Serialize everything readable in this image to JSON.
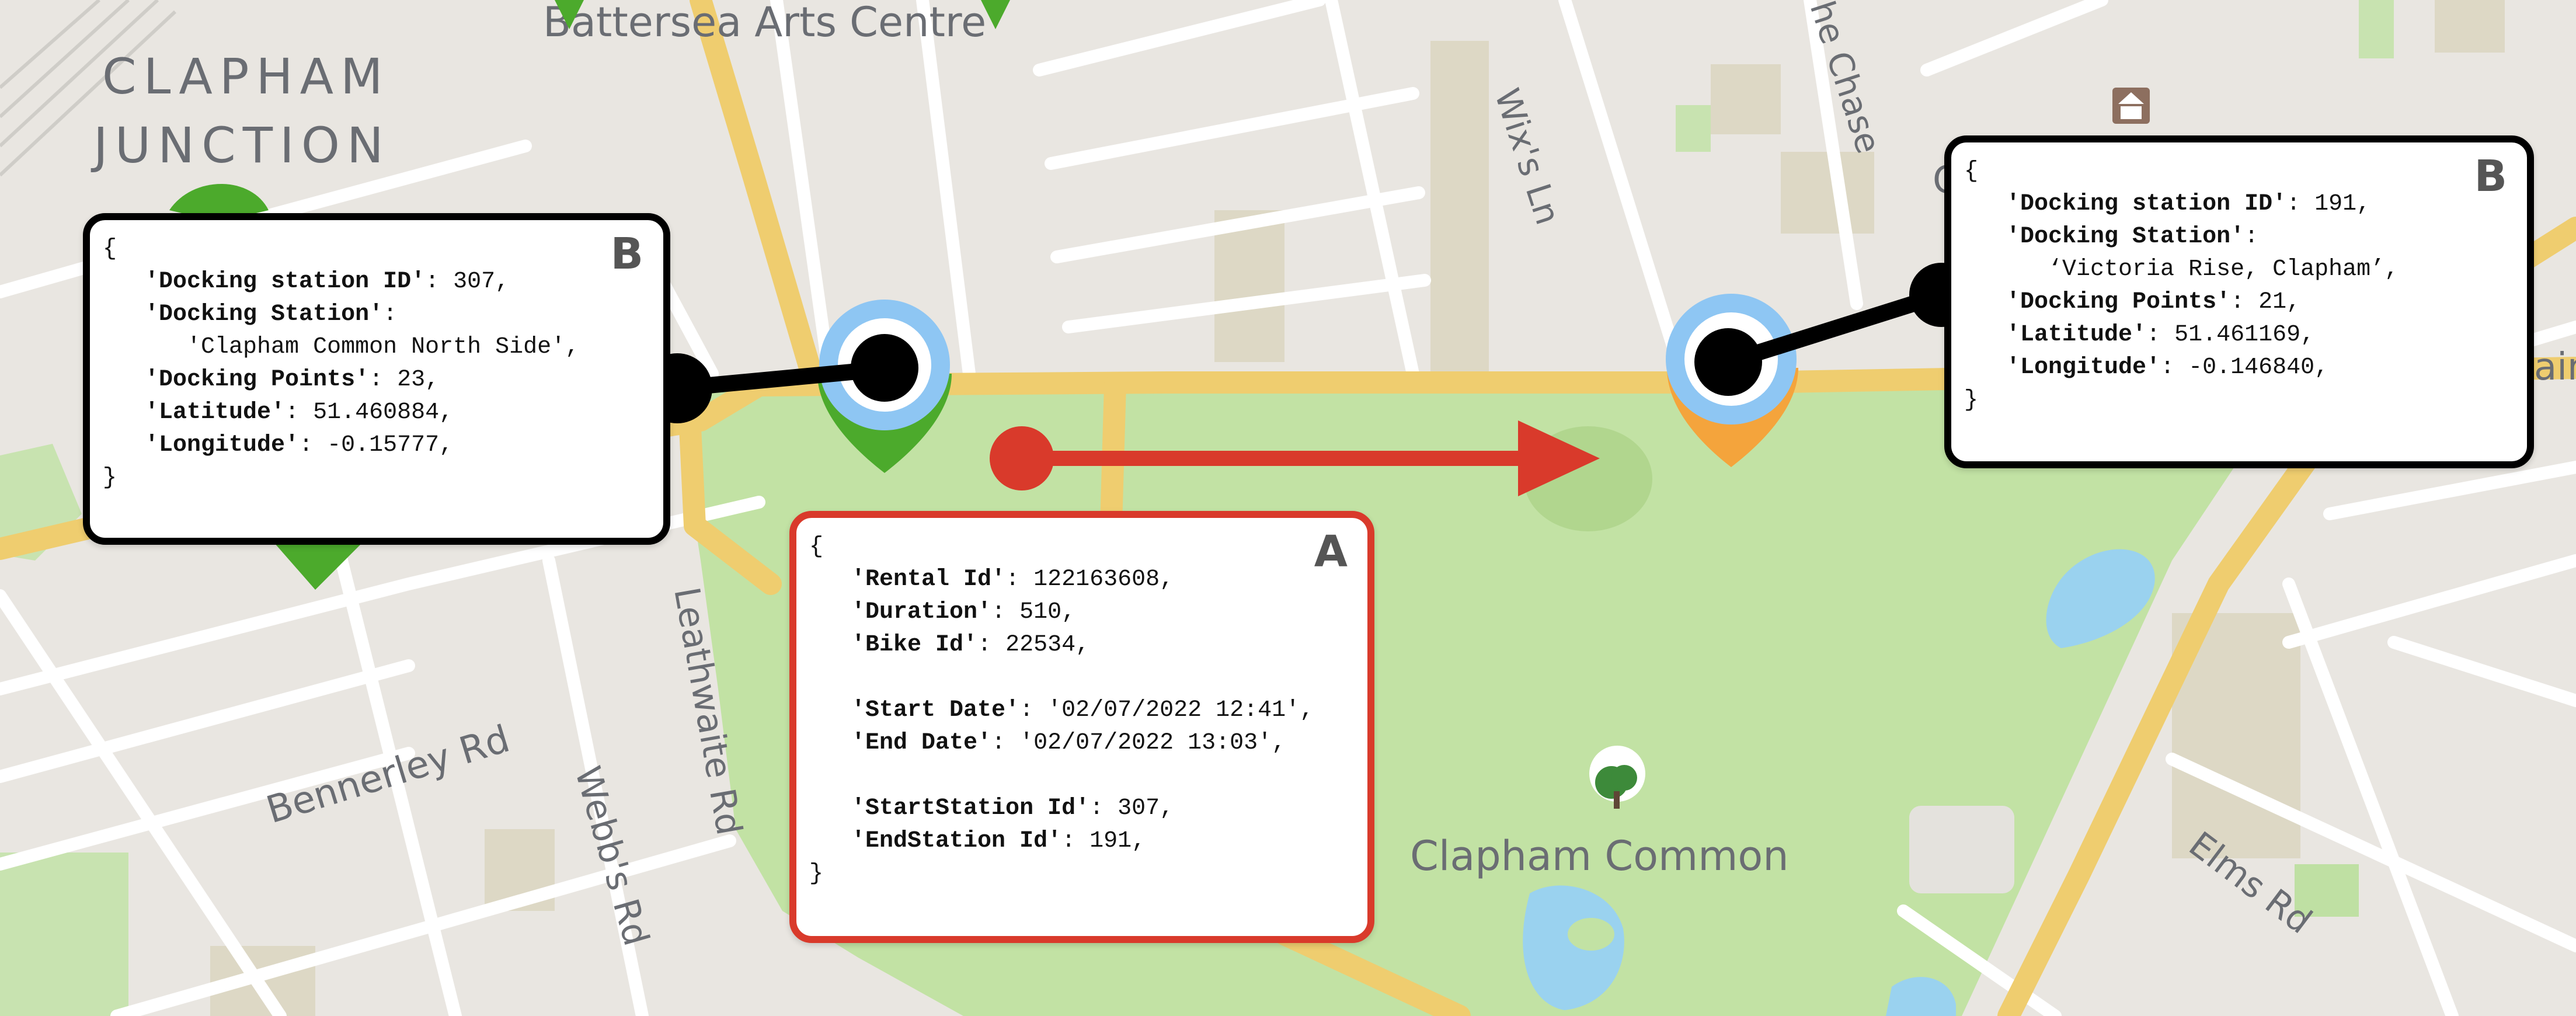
{
  "map": {
    "places": {
      "clapham_junction_line1": "CLAPHAM",
      "clapham_junction_line2": "JUNCTION",
      "battersea_arts_centre": "Battersea Arts Centre",
      "clapham_common": "Clapham Common",
      "the_chase": "he Chase",
      "wixs_ln": "Wix's Ln",
      "bennerley_rd": "Bennerley Rd",
      "leathwaite_rd": "Leathwaite Rd",
      "webbs_rd": "Webb's Rd",
      "elms_rd": "Elms Rd",
      "partial_c": "C",
      "partial_ain": "ain"
    },
    "colors": {
      "land": "#e9e6e1",
      "park": "#c2e2a4",
      "water": "#9ad2ef",
      "main_road": "#efcd6f",
      "building": "#d8d4c6",
      "station_pin_full": "#4caa2c",
      "station_pin_empty": "#f4a43c",
      "station_ring": "#8ec6f3",
      "trip_arrow": "#d93a2b"
    },
    "icons": {
      "museum": "museum-icon",
      "tree": "tree-icon"
    }
  },
  "callouts": {
    "start_station": {
      "badge": "B",
      "open": "{",
      "close": "}",
      "rows": [
        {
          "key": "'Docking station ID'",
          "rest": ": 307,"
        },
        {
          "key": "'Docking Station'",
          "rest": ":"
        },
        {
          "key": "",
          "rest": "   'Clapham Common North Side',"
        },
        {
          "key": "'Docking Points'",
          "rest": ": 23,"
        },
        {
          "key": "'Latitude'",
          "rest": ": 51.460884,"
        },
        {
          "key": "'Longitude'",
          "rest": ": -0.15777,"
        }
      ]
    },
    "rental": {
      "badge": "A",
      "open": "{",
      "close": "}",
      "rows": [
        {
          "key": "'Rental Id'",
          "rest": ": 122163608,"
        },
        {
          "key": "'Duration'",
          "rest": ": 510,"
        },
        {
          "key": "'Bike Id'",
          "rest": ": 22534,"
        },
        {
          "key": "",
          "rest": ""
        },
        {
          "key": "'Start Date'",
          "rest": ": '02/07/2022 12:41',"
        },
        {
          "key": "'End Date'",
          "rest": ": '02/07/2022 13:03',"
        },
        {
          "key": "",
          "rest": ""
        },
        {
          "key": "'StartStation Id'",
          "rest": ": 307,"
        },
        {
          "key": "'EndStation Id'",
          "rest": ": 191,"
        }
      ]
    },
    "end_station": {
      "badge": "B",
      "open": "{",
      "close": "}",
      "rows": [
        {
          "key": "'Docking station ID'",
          "rest": ": 191,"
        },
        {
          "key": "'Docking Station'",
          "rest": ":"
        },
        {
          "key": "",
          "rest": "   ‘Victoria Rise, Clapham’,"
        },
        {
          "key": "'Docking Points'",
          "rest": ": 21,"
        },
        {
          "key": "'Latitude'",
          "rest": ": 51.461169,"
        },
        {
          "key": "'Longitude'",
          "rest": ": -0.146840,"
        }
      ]
    }
  }
}
